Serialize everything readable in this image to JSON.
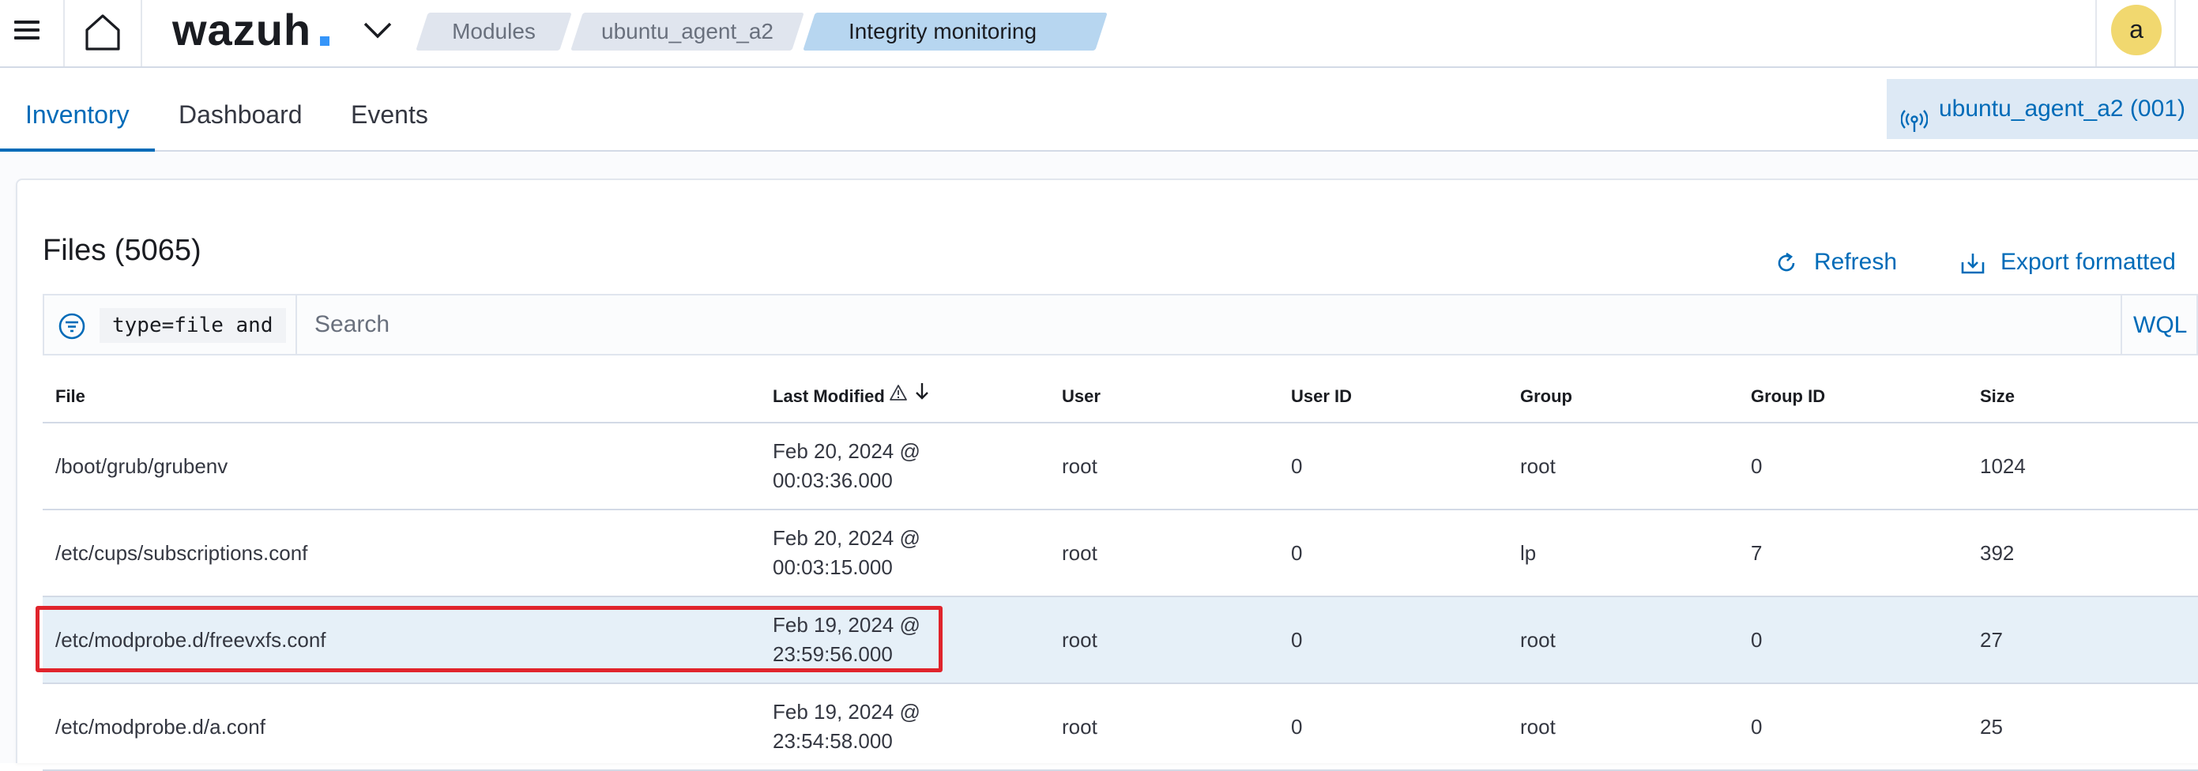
{
  "header": {
    "logo_text": "wazuh",
    "breadcrumbs": [
      {
        "label": "Modules"
      },
      {
        "label": "ubuntu_agent_a2"
      },
      {
        "label": "Integrity monitoring"
      }
    ],
    "avatar_initial": "a",
    "colors": {
      "accent": "#006bb8",
      "logo_dot": "#3595f9",
      "avatar": "#f1d86f"
    }
  },
  "tabs": [
    {
      "label": "Inventory",
      "active": true
    },
    {
      "label": "Dashboard",
      "active": false
    },
    {
      "label": "Events",
      "active": false
    }
  ],
  "agent_chip": {
    "label": "ubuntu_agent_a2 (001)",
    "icon": "antenna-icon"
  },
  "files_panel": {
    "title": "Files (5065)",
    "refresh_label": "Refresh",
    "export_label": "Export formatted"
  },
  "search": {
    "query_chip": "type=file and",
    "placeholder": "Search",
    "wql_label": "WQL"
  },
  "table": {
    "columns": [
      "File",
      "Last Modified",
      "User",
      "User ID",
      "Group",
      "Group ID",
      "Size"
    ],
    "sort": {
      "column": "Last Modified",
      "direction": "descending"
    },
    "rows": [
      {
        "file": "/boot/grub/grubenv",
        "date": "Feb 20, 2024 @",
        "time": "00:03:36.000",
        "user": "root",
        "user_id": "0",
        "group": "root",
        "group_id": "0",
        "size": "1024"
      },
      {
        "file": "/etc/cups/subscriptions.conf",
        "date": "Feb 20, 2024 @",
        "time": "00:03:15.000",
        "user": "root",
        "user_id": "0",
        "group": "lp",
        "group_id": "7",
        "size": "392"
      },
      {
        "file": "/etc/modprobe.d/freevxfs.conf",
        "date": "Feb 19, 2024 @",
        "time": "23:59:56.000",
        "user": "root",
        "user_id": "0",
        "group": "root",
        "group_id": "0",
        "size": "27"
      },
      {
        "file": "/etc/modprobe.d/a.conf",
        "date": "Feb 19, 2024 @",
        "time": "23:54:58.000",
        "user": "root",
        "user_id": "0",
        "group": "root",
        "group_id": "0",
        "size": "25"
      }
    ]
  }
}
